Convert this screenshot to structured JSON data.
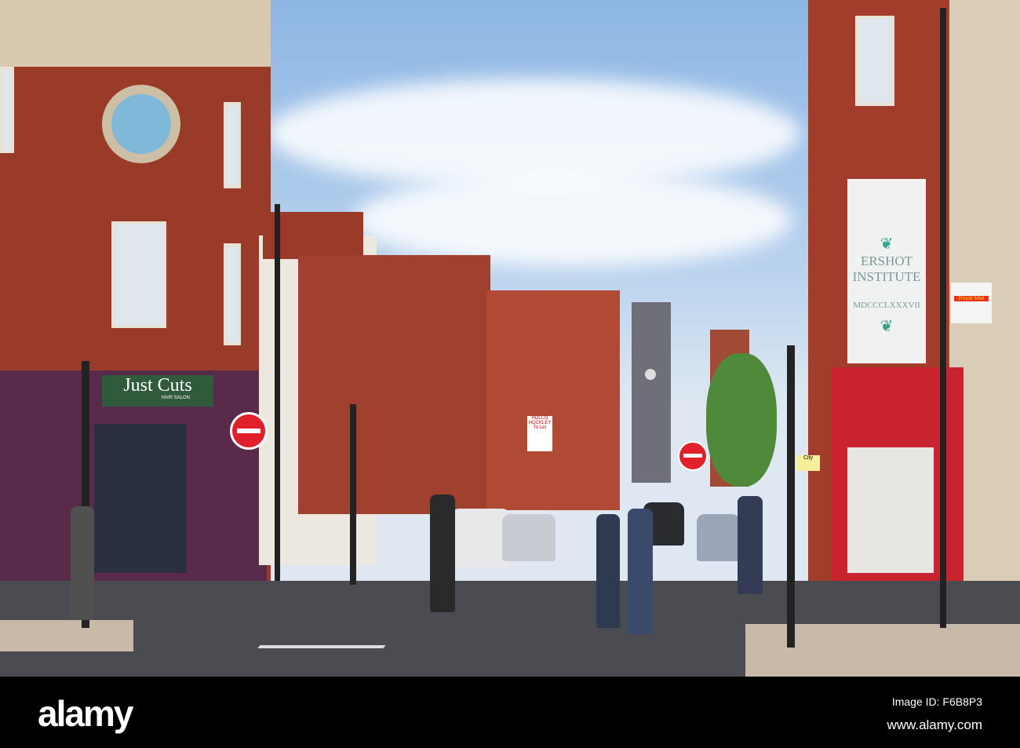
{
  "shops": {
    "salon_name": "Just Cuts",
    "salon_sub": "HAIR SALON",
    "institute_line1": "ERSHOT",
    "institute_line2": "INSTITUTE",
    "institute_date": "MDCCCLXXXVII",
    "royal_mail": "Royal Mail",
    "agent_sign": "HOLLIS HOCKLEY",
    "to_let": "To Let",
    "city_sign": "City"
  },
  "watermark": {
    "logo": "alamy",
    "image_id": "Image ID: F6B8P3",
    "url": "www.alamy.com"
  },
  "colors": {
    "brick": "#9a3b2a",
    "sky": "#8db6e4",
    "road": "#4a4c52",
    "salon_sign": "#2f5a3c",
    "mail_red": "#e8321f"
  }
}
